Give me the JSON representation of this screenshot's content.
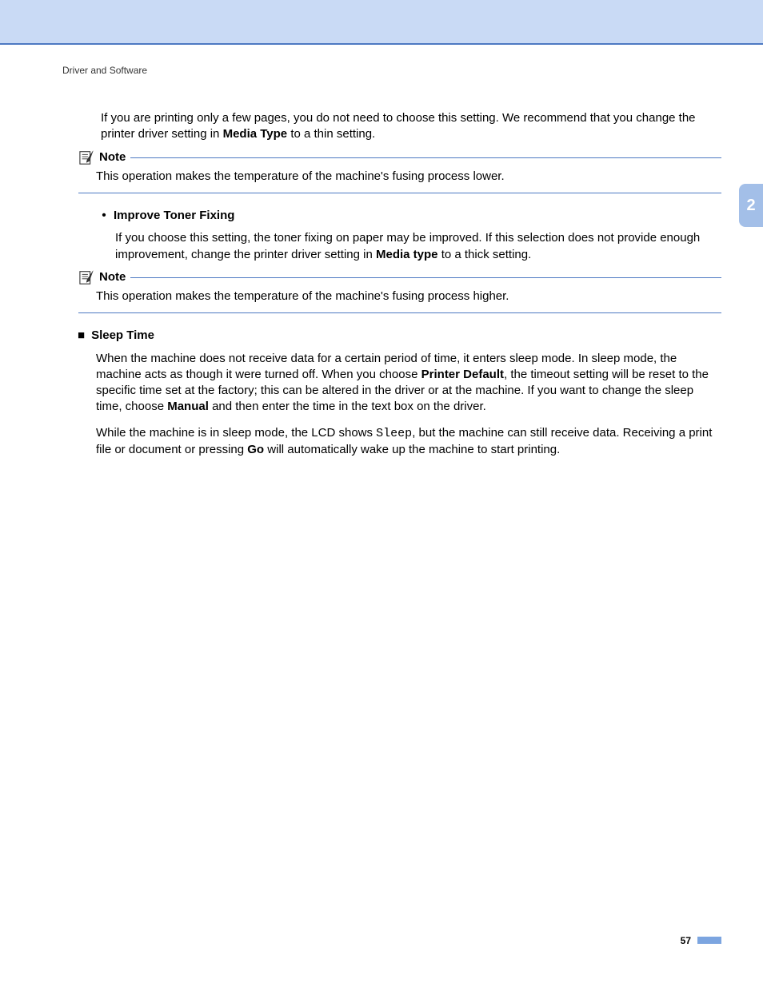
{
  "header": {
    "breadcrumb": "Driver and Software"
  },
  "chapter_tab": "2",
  "page_number": "57",
  "intro": {
    "line1_pre": "If you are printing only a few pages, you do not need to choose this setting. We recommend that you change the printer driver setting in ",
    "bold1": "Media Type",
    "line1_post": " to a thin setting."
  },
  "note1": {
    "label": "Note",
    "body": "This operation makes the temperature of the machine's fusing process lower."
  },
  "toner": {
    "title": "Improve Toner Fixing",
    "body_pre": "If you choose this setting, the toner fixing on paper may be improved. If this selection does not provide enough improvement, change the printer driver setting in ",
    "bold1": "Media type",
    "body_post": " to a thick setting."
  },
  "note2": {
    "label": "Note",
    "body": "This operation makes the temperature of the machine's fusing process higher."
  },
  "sleep": {
    "title": "Sleep Time",
    "p1_a": "When the machine does not receive data for a certain period of time, it enters sleep mode. In sleep mode, the machine acts as though it were turned off. When you choose ",
    "p1_b1": "Printer Default",
    "p1_b": ", the timeout setting will be reset to the specific time set at the factory; this can be altered in the driver or at the machine. If you want to change the sleep time, choose ",
    "p1_b2": "Manual",
    "p1_c": " and then enter the time in the text box on the driver.",
    "p2_a": "While the machine is in sleep mode, the LCD shows ",
    "p2_code": "Sleep",
    "p2_b": ", but the machine can still receive data. Receiving a print file or document or pressing ",
    "p2_bold": "Go",
    "p2_c": " will automatically wake up the machine to start printing."
  }
}
